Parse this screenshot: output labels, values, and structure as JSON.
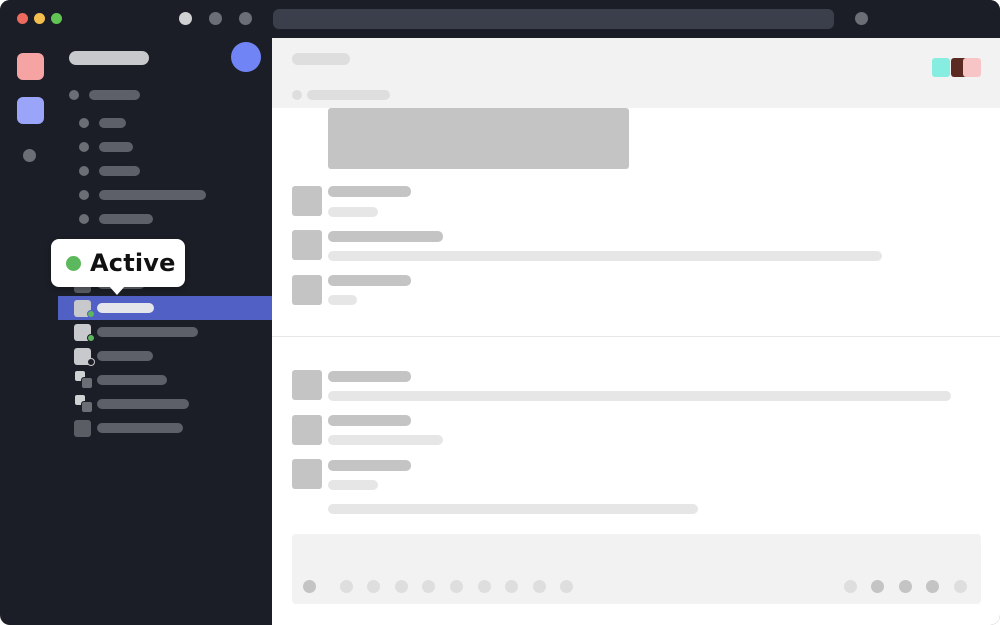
{
  "tooltip": {
    "label": "Active",
    "status_color": "#5cb85c"
  },
  "colors": {
    "sidebar_bg": "#1b1e26",
    "active_row": "#5160c5",
    "avatar": "#7184f6",
    "server_1": "#f5a3a3",
    "server_2": "#9aa5fa",
    "status_online": "#5cb85c"
  },
  "header": {
    "theme_swatches": [
      "#86ede0",
      "#5b2a22",
      "#f7c5c5"
    ]
  },
  "titlebar": {
    "traffic_lights": [
      "#ed6a5e",
      "#f4bf4f",
      "#61c554"
    ]
  },
  "icons": {
    "toolbar": [
      "circle-icon",
      "circle-icon",
      "circle-icon"
    ],
    "titlebar_right": "circle-icon",
    "composer_left": [
      "plus-icon",
      "emoji-icon"
    ],
    "composer_right": [
      "gif-icon",
      "sticker-icon",
      "attach-icon",
      "more-icon"
    ]
  }
}
